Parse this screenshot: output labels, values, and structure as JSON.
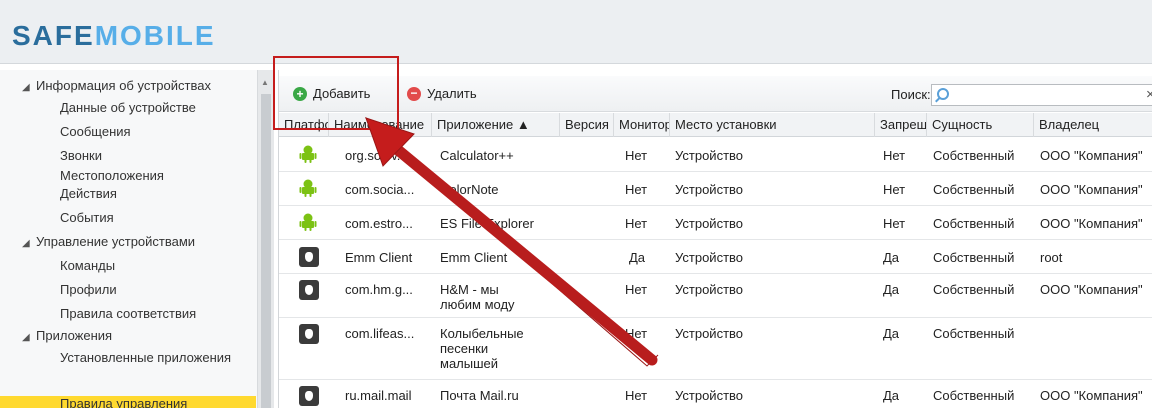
{
  "logo": {
    "part1": "SAFE",
    "part2": "MOBILE"
  },
  "sidebar": {
    "groups": [
      {
        "label": "Информация об устройствах",
        "children": [
          "Данные об устройстве",
          "Сообщения",
          "Звонки",
          "Местоположения",
          "Действия",
          "События"
        ]
      },
      {
        "label": "Управление устройствами",
        "children": [
          "Команды",
          "Профили",
          "Правила соответствия"
        ]
      },
      {
        "label": "Приложения",
        "children": [
          "Установленные приложения",
          "Правила управления"
        ]
      }
    ],
    "selected": "Правила управления"
  },
  "toolbar": {
    "add_label": "Добавить",
    "delete_label": "Удалить",
    "search_label": "Поиск:",
    "search_value": "",
    "clear": "×"
  },
  "table": {
    "columns": [
      "Платформа",
      "Наименование",
      "Приложение ▲",
      "Версия",
      "Мониторинг",
      "Место установки",
      "Запрещено",
      "Сущность",
      "Владелец"
    ],
    "rows": [
      {
        "platform": "android",
        "name": "org.solov...",
        "app": "Calculator++",
        "version": "",
        "monitor": "Нет",
        "location": "Устройство",
        "forbidden": "Нет",
        "entity": "Собственный",
        "owner": "ООО \"Компания\""
      },
      {
        "platform": "android",
        "name": "com.socia...",
        "app": "ColorNote",
        "version": "",
        "monitor": "Нет",
        "location": "Устройство",
        "forbidden": "Нет",
        "entity": "Собственный",
        "owner": "ООО \"Компания\""
      },
      {
        "platform": "android",
        "name": "com.estro...",
        "app": "ES File Explorer",
        "version": "",
        "monitor": "Нет",
        "location": "Устройство",
        "forbidden": "Нет",
        "entity": "Собственный",
        "owner": "ООО \"Компания\""
      },
      {
        "platform": "ios",
        "name": "Emm Client",
        "app": "Emm Client",
        "version": "",
        "monitor": "Да",
        "location": "Устройство",
        "forbidden": "Да",
        "entity": "Собственный",
        "owner": "root"
      },
      {
        "platform": "ios",
        "name": "com.hm.g...",
        "app": "H&M - мы любим моду",
        "version": "",
        "monitor": "Нет",
        "location": "Устройство",
        "forbidden": "Да",
        "entity": "Собственный",
        "owner": "ООО \"Компания\""
      },
      {
        "platform": "ios",
        "name": "com.lifeas...",
        "app": "Колыбельные песенки малышей",
        "version": "",
        "monitor": "Нет",
        "location": "Устройство",
        "forbidden": "Да",
        "entity": "Собственный",
        "owner": ""
      },
      {
        "platform": "ios",
        "name": "ru.mail.mail",
        "app": "Почта Mail.ru",
        "version": "",
        "monitor": "Нет",
        "location": "Устройство",
        "forbidden": "Да",
        "entity": "Собственный",
        "owner": "ООО \"Компания\""
      }
    ]
  },
  "colors": {
    "highlight": "#c51c1c",
    "selected": "#ffd92f",
    "android": "#7cc214",
    "logo_dark": "#2a6d9c",
    "logo_light": "#57aee8"
  }
}
